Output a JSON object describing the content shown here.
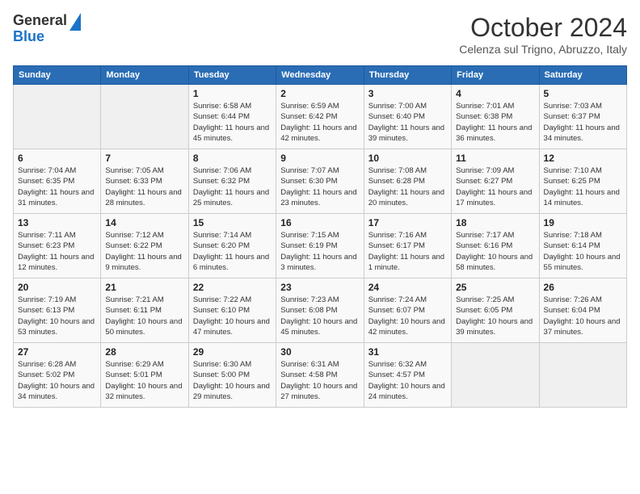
{
  "logo": {
    "line1": "General",
    "line2": "Blue"
  },
  "title": "October 2024",
  "location": "Celenza sul Trigno, Abruzzo, Italy",
  "weekdays": [
    "Sunday",
    "Monday",
    "Tuesday",
    "Wednesday",
    "Thursday",
    "Friday",
    "Saturday"
  ],
  "weeks": [
    [
      {
        "day": "",
        "sunrise": "",
        "sunset": "",
        "daylight": ""
      },
      {
        "day": "",
        "sunrise": "",
        "sunset": "",
        "daylight": ""
      },
      {
        "day": "1",
        "sunrise": "Sunrise: 6:58 AM",
        "sunset": "Sunset: 6:44 PM",
        "daylight": "Daylight: 11 hours and 45 minutes."
      },
      {
        "day": "2",
        "sunrise": "Sunrise: 6:59 AM",
        "sunset": "Sunset: 6:42 PM",
        "daylight": "Daylight: 11 hours and 42 minutes."
      },
      {
        "day": "3",
        "sunrise": "Sunrise: 7:00 AM",
        "sunset": "Sunset: 6:40 PM",
        "daylight": "Daylight: 11 hours and 39 minutes."
      },
      {
        "day": "4",
        "sunrise": "Sunrise: 7:01 AM",
        "sunset": "Sunset: 6:38 PM",
        "daylight": "Daylight: 11 hours and 36 minutes."
      },
      {
        "day": "5",
        "sunrise": "Sunrise: 7:03 AM",
        "sunset": "Sunset: 6:37 PM",
        "daylight": "Daylight: 11 hours and 34 minutes."
      }
    ],
    [
      {
        "day": "6",
        "sunrise": "Sunrise: 7:04 AM",
        "sunset": "Sunset: 6:35 PM",
        "daylight": "Daylight: 11 hours and 31 minutes."
      },
      {
        "day": "7",
        "sunrise": "Sunrise: 7:05 AM",
        "sunset": "Sunset: 6:33 PM",
        "daylight": "Daylight: 11 hours and 28 minutes."
      },
      {
        "day": "8",
        "sunrise": "Sunrise: 7:06 AM",
        "sunset": "Sunset: 6:32 PM",
        "daylight": "Daylight: 11 hours and 25 minutes."
      },
      {
        "day": "9",
        "sunrise": "Sunrise: 7:07 AM",
        "sunset": "Sunset: 6:30 PM",
        "daylight": "Daylight: 11 hours and 23 minutes."
      },
      {
        "day": "10",
        "sunrise": "Sunrise: 7:08 AM",
        "sunset": "Sunset: 6:28 PM",
        "daylight": "Daylight: 11 hours and 20 minutes."
      },
      {
        "day": "11",
        "sunrise": "Sunrise: 7:09 AM",
        "sunset": "Sunset: 6:27 PM",
        "daylight": "Daylight: 11 hours and 17 minutes."
      },
      {
        "day": "12",
        "sunrise": "Sunrise: 7:10 AM",
        "sunset": "Sunset: 6:25 PM",
        "daylight": "Daylight: 11 hours and 14 minutes."
      }
    ],
    [
      {
        "day": "13",
        "sunrise": "Sunrise: 7:11 AM",
        "sunset": "Sunset: 6:23 PM",
        "daylight": "Daylight: 11 hours and 12 minutes."
      },
      {
        "day": "14",
        "sunrise": "Sunrise: 7:12 AM",
        "sunset": "Sunset: 6:22 PM",
        "daylight": "Daylight: 11 hours and 9 minutes."
      },
      {
        "day": "15",
        "sunrise": "Sunrise: 7:14 AM",
        "sunset": "Sunset: 6:20 PM",
        "daylight": "Daylight: 11 hours and 6 minutes."
      },
      {
        "day": "16",
        "sunrise": "Sunrise: 7:15 AM",
        "sunset": "Sunset: 6:19 PM",
        "daylight": "Daylight: 11 hours and 3 minutes."
      },
      {
        "day": "17",
        "sunrise": "Sunrise: 7:16 AM",
        "sunset": "Sunset: 6:17 PM",
        "daylight": "Daylight: 11 hours and 1 minute."
      },
      {
        "day": "18",
        "sunrise": "Sunrise: 7:17 AM",
        "sunset": "Sunset: 6:16 PM",
        "daylight": "Daylight: 10 hours and 58 minutes."
      },
      {
        "day": "19",
        "sunrise": "Sunrise: 7:18 AM",
        "sunset": "Sunset: 6:14 PM",
        "daylight": "Daylight: 10 hours and 55 minutes."
      }
    ],
    [
      {
        "day": "20",
        "sunrise": "Sunrise: 7:19 AM",
        "sunset": "Sunset: 6:13 PM",
        "daylight": "Daylight: 10 hours and 53 minutes."
      },
      {
        "day": "21",
        "sunrise": "Sunrise: 7:21 AM",
        "sunset": "Sunset: 6:11 PM",
        "daylight": "Daylight: 10 hours and 50 minutes."
      },
      {
        "day": "22",
        "sunrise": "Sunrise: 7:22 AM",
        "sunset": "Sunset: 6:10 PM",
        "daylight": "Daylight: 10 hours and 47 minutes."
      },
      {
        "day": "23",
        "sunrise": "Sunrise: 7:23 AM",
        "sunset": "Sunset: 6:08 PM",
        "daylight": "Daylight: 10 hours and 45 minutes."
      },
      {
        "day": "24",
        "sunrise": "Sunrise: 7:24 AM",
        "sunset": "Sunset: 6:07 PM",
        "daylight": "Daylight: 10 hours and 42 minutes."
      },
      {
        "day": "25",
        "sunrise": "Sunrise: 7:25 AM",
        "sunset": "Sunset: 6:05 PM",
        "daylight": "Daylight: 10 hours and 39 minutes."
      },
      {
        "day": "26",
        "sunrise": "Sunrise: 7:26 AM",
        "sunset": "Sunset: 6:04 PM",
        "daylight": "Daylight: 10 hours and 37 minutes."
      }
    ],
    [
      {
        "day": "27",
        "sunrise": "Sunrise: 6:28 AM",
        "sunset": "Sunset: 5:02 PM",
        "daylight": "Daylight: 10 hours and 34 minutes."
      },
      {
        "day": "28",
        "sunrise": "Sunrise: 6:29 AM",
        "sunset": "Sunset: 5:01 PM",
        "daylight": "Daylight: 10 hours and 32 minutes."
      },
      {
        "day": "29",
        "sunrise": "Sunrise: 6:30 AM",
        "sunset": "Sunset: 5:00 PM",
        "daylight": "Daylight: 10 hours and 29 minutes."
      },
      {
        "day": "30",
        "sunrise": "Sunrise: 6:31 AM",
        "sunset": "Sunset: 4:58 PM",
        "daylight": "Daylight: 10 hours and 27 minutes."
      },
      {
        "day": "31",
        "sunrise": "Sunrise: 6:32 AM",
        "sunset": "Sunset: 4:57 PM",
        "daylight": "Daylight: 10 hours and 24 minutes."
      },
      {
        "day": "",
        "sunrise": "",
        "sunset": "",
        "daylight": ""
      },
      {
        "day": "",
        "sunrise": "",
        "sunset": "",
        "daylight": ""
      }
    ]
  ]
}
